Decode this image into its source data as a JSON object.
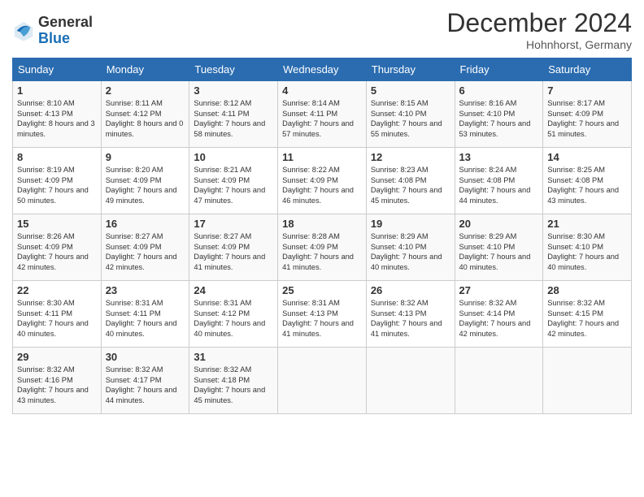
{
  "header": {
    "logo_general": "General",
    "logo_blue": "Blue",
    "month_title": "December 2024",
    "location": "Hohnhorst, Germany"
  },
  "days_of_week": [
    "Sunday",
    "Monday",
    "Tuesday",
    "Wednesday",
    "Thursday",
    "Friday",
    "Saturday"
  ],
  "weeks": [
    [
      {
        "day": "1",
        "sunrise": "Sunrise: 8:10 AM",
        "sunset": "Sunset: 4:13 PM",
        "daylight": "Daylight: 8 hours and 3 minutes."
      },
      {
        "day": "2",
        "sunrise": "Sunrise: 8:11 AM",
        "sunset": "Sunset: 4:12 PM",
        "daylight": "Daylight: 8 hours and 0 minutes."
      },
      {
        "day": "3",
        "sunrise": "Sunrise: 8:12 AM",
        "sunset": "Sunset: 4:11 PM",
        "daylight": "Daylight: 7 hours and 58 minutes."
      },
      {
        "day": "4",
        "sunrise": "Sunrise: 8:14 AM",
        "sunset": "Sunset: 4:11 PM",
        "daylight": "Daylight: 7 hours and 57 minutes."
      },
      {
        "day": "5",
        "sunrise": "Sunrise: 8:15 AM",
        "sunset": "Sunset: 4:10 PM",
        "daylight": "Daylight: 7 hours and 55 minutes."
      },
      {
        "day": "6",
        "sunrise": "Sunrise: 8:16 AM",
        "sunset": "Sunset: 4:10 PM",
        "daylight": "Daylight: 7 hours and 53 minutes."
      },
      {
        "day": "7",
        "sunrise": "Sunrise: 8:17 AM",
        "sunset": "Sunset: 4:09 PM",
        "daylight": "Daylight: 7 hours and 51 minutes."
      }
    ],
    [
      {
        "day": "8",
        "sunrise": "Sunrise: 8:19 AM",
        "sunset": "Sunset: 4:09 PM",
        "daylight": "Daylight: 7 hours and 50 minutes."
      },
      {
        "day": "9",
        "sunrise": "Sunrise: 8:20 AM",
        "sunset": "Sunset: 4:09 PM",
        "daylight": "Daylight: 7 hours and 49 minutes."
      },
      {
        "day": "10",
        "sunrise": "Sunrise: 8:21 AM",
        "sunset": "Sunset: 4:09 PM",
        "daylight": "Daylight: 7 hours and 47 minutes."
      },
      {
        "day": "11",
        "sunrise": "Sunrise: 8:22 AM",
        "sunset": "Sunset: 4:09 PM",
        "daylight": "Daylight: 7 hours and 46 minutes."
      },
      {
        "day": "12",
        "sunrise": "Sunrise: 8:23 AM",
        "sunset": "Sunset: 4:08 PM",
        "daylight": "Daylight: 7 hours and 45 minutes."
      },
      {
        "day": "13",
        "sunrise": "Sunrise: 8:24 AM",
        "sunset": "Sunset: 4:08 PM",
        "daylight": "Daylight: 7 hours and 44 minutes."
      },
      {
        "day": "14",
        "sunrise": "Sunrise: 8:25 AM",
        "sunset": "Sunset: 4:08 PM",
        "daylight": "Daylight: 7 hours and 43 minutes."
      }
    ],
    [
      {
        "day": "15",
        "sunrise": "Sunrise: 8:26 AM",
        "sunset": "Sunset: 4:09 PM",
        "daylight": "Daylight: 7 hours and 42 minutes."
      },
      {
        "day": "16",
        "sunrise": "Sunrise: 8:27 AM",
        "sunset": "Sunset: 4:09 PM",
        "daylight": "Daylight: 7 hours and 42 minutes."
      },
      {
        "day": "17",
        "sunrise": "Sunrise: 8:27 AM",
        "sunset": "Sunset: 4:09 PM",
        "daylight": "Daylight: 7 hours and 41 minutes."
      },
      {
        "day": "18",
        "sunrise": "Sunrise: 8:28 AM",
        "sunset": "Sunset: 4:09 PM",
        "daylight": "Daylight: 7 hours and 41 minutes."
      },
      {
        "day": "19",
        "sunrise": "Sunrise: 8:29 AM",
        "sunset": "Sunset: 4:10 PM",
        "daylight": "Daylight: 7 hours and 40 minutes."
      },
      {
        "day": "20",
        "sunrise": "Sunrise: 8:29 AM",
        "sunset": "Sunset: 4:10 PM",
        "daylight": "Daylight: 7 hours and 40 minutes."
      },
      {
        "day": "21",
        "sunrise": "Sunrise: 8:30 AM",
        "sunset": "Sunset: 4:10 PM",
        "daylight": "Daylight: 7 hours and 40 minutes."
      }
    ],
    [
      {
        "day": "22",
        "sunrise": "Sunrise: 8:30 AM",
        "sunset": "Sunset: 4:11 PM",
        "daylight": "Daylight: 7 hours and 40 minutes."
      },
      {
        "day": "23",
        "sunrise": "Sunrise: 8:31 AM",
        "sunset": "Sunset: 4:11 PM",
        "daylight": "Daylight: 7 hours and 40 minutes."
      },
      {
        "day": "24",
        "sunrise": "Sunrise: 8:31 AM",
        "sunset": "Sunset: 4:12 PM",
        "daylight": "Daylight: 7 hours and 40 minutes."
      },
      {
        "day": "25",
        "sunrise": "Sunrise: 8:31 AM",
        "sunset": "Sunset: 4:13 PM",
        "daylight": "Daylight: 7 hours and 41 minutes."
      },
      {
        "day": "26",
        "sunrise": "Sunrise: 8:32 AM",
        "sunset": "Sunset: 4:13 PM",
        "daylight": "Daylight: 7 hours and 41 minutes."
      },
      {
        "day": "27",
        "sunrise": "Sunrise: 8:32 AM",
        "sunset": "Sunset: 4:14 PM",
        "daylight": "Daylight: 7 hours and 42 minutes."
      },
      {
        "day": "28",
        "sunrise": "Sunrise: 8:32 AM",
        "sunset": "Sunset: 4:15 PM",
        "daylight": "Daylight: 7 hours and 42 minutes."
      }
    ],
    [
      {
        "day": "29",
        "sunrise": "Sunrise: 8:32 AM",
        "sunset": "Sunset: 4:16 PM",
        "daylight": "Daylight: 7 hours and 43 minutes."
      },
      {
        "day": "30",
        "sunrise": "Sunrise: 8:32 AM",
        "sunset": "Sunset: 4:17 PM",
        "daylight": "Daylight: 7 hours and 44 minutes."
      },
      {
        "day": "31",
        "sunrise": "Sunrise: 8:32 AM",
        "sunset": "Sunset: 4:18 PM",
        "daylight": "Daylight: 7 hours and 45 minutes."
      },
      null,
      null,
      null,
      null
    ]
  ]
}
